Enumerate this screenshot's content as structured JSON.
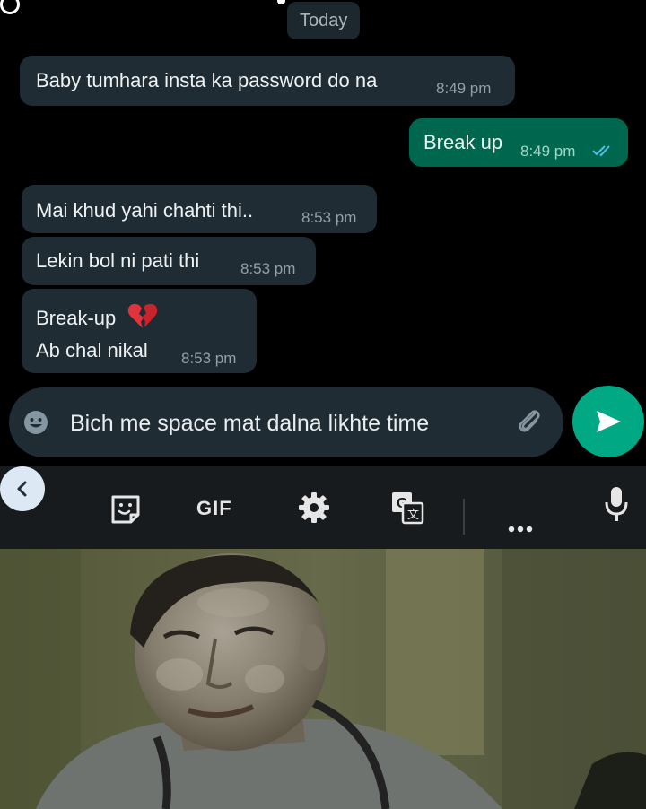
{
  "chat": {
    "date_divider": "Today",
    "messages": [
      {
        "direction": "incoming",
        "text": "Baby tumhara insta ka password do na",
        "time": "8:49 pm"
      },
      {
        "direction": "outgoing",
        "text": "Break up",
        "time": "8:49 pm",
        "status": "read"
      },
      {
        "direction": "incoming",
        "text": "Mai khud yahi chahti thi..",
        "time": "8:53 pm"
      },
      {
        "direction": "incoming",
        "text": "Lekin bol ni pati thi",
        "time": "8:53 pm"
      },
      {
        "direction": "incoming",
        "lines": [
          "Break-up",
          "Ab chal nikal"
        ],
        "emoji": "broken-heart",
        "time": "8:53 pm"
      }
    ]
  },
  "composer": {
    "text": "Bich me space mat dalna likhte time",
    "icons": {
      "emoji": "emoji-icon",
      "attach": "paperclip-icon",
      "send": "send-icon"
    }
  },
  "keyboard_toolbar": {
    "gif_label": "GIF",
    "icons": [
      "back-chevron-icon",
      "sticker-icon",
      "gif",
      "settings-gear-icon",
      "translate-icon",
      "more-dots-icon",
      "microphone-icon"
    ]
  },
  "colors": {
    "background": "#000000",
    "incoming_bubble": "#1f2c33",
    "outgoing_bubble": "#00674f",
    "send_button": "#00a884",
    "read_ticks": "#53bdeb"
  }
}
